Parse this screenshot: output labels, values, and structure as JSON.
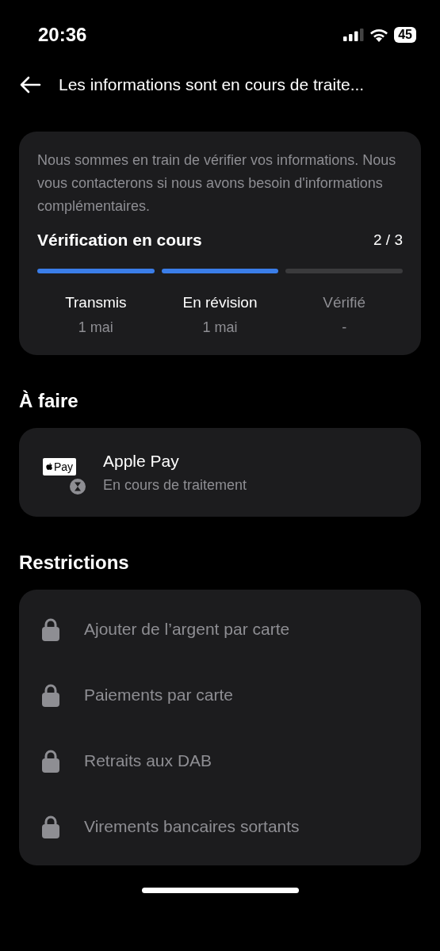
{
  "status_bar": {
    "time": "20:36",
    "battery": "45"
  },
  "header": {
    "title": "Les informations sont en cours de traite..."
  },
  "verification": {
    "message": "Nous sommes en train de vérifier vos informations. Nous vous contacterons si nous avons besoin d'informations complémentaires.",
    "title": "Vérification en cours",
    "progress": "2 / 3",
    "steps": [
      {
        "label": "Transmis",
        "date": "1 mai",
        "completed": true
      },
      {
        "label": "En révision",
        "date": "1 mai",
        "completed": true
      },
      {
        "label": "Vérifié",
        "date": "-",
        "completed": false
      }
    ]
  },
  "todo": {
    "heading": "À faire",
    "items": [
      {
        "title": "Apple Pay",
        "logo_text": "Pay",
        "status": "En cours de traitement"
      }
    ]
  },
  "restrictions": {
    "heading": "Restrictions",
    "items": [
      {
        "label": "Ajouter de l’argent par carte"
      },
      {
        "label": "Paiements par carte"
      },
      {
        "label": "Retraits aux DAB"
      },
      {
        "label": "Virements bancaires sortants"
      }
    ]
  }
}
